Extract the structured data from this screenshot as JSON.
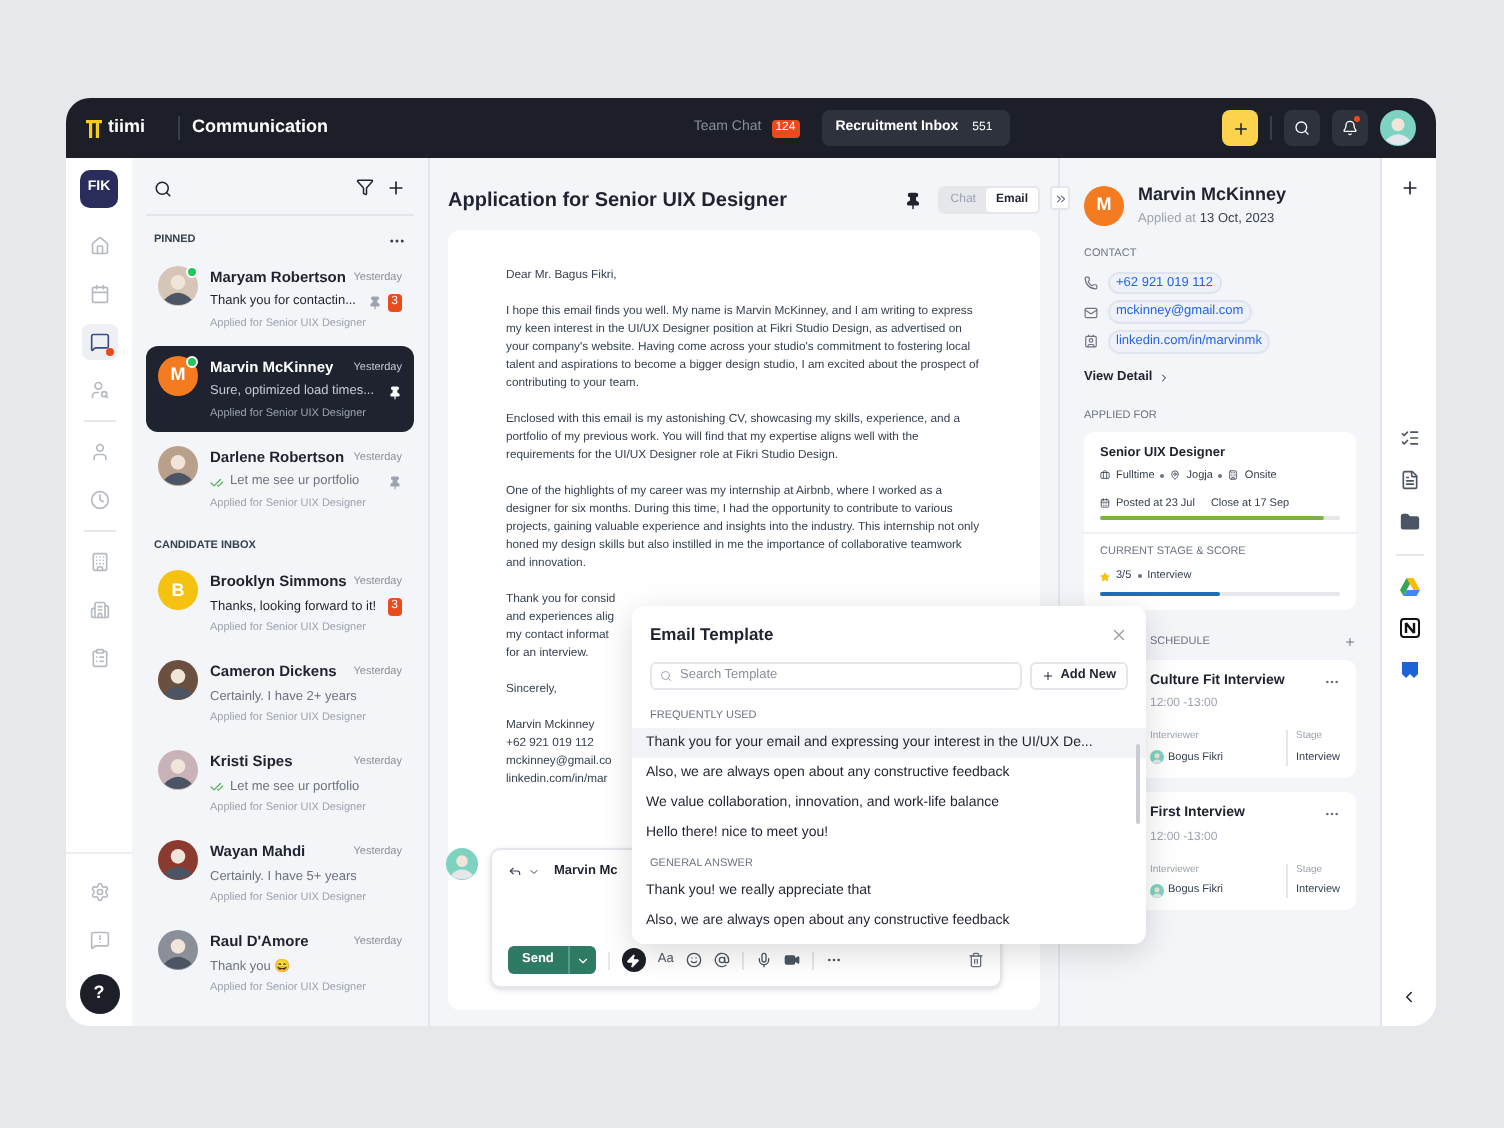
{
  "topbar": {
    "logo": "tiimi",
    "title": "Communication",
    "tabs": [
      {
        "label": "Team Chat",
        "count": "124",
        "selected": false
      },
      {
        "label": "Recruitment Inbox",
        "count": "551",
        "selected": true
      }
    ],
    "notification_dot": true
  },
  "rail": {
    "workspace": "FIK",
    "help": "?",
    "items": [
      {
        "selected": false,
        "badge": false
      },
      {
        "selected": false,
        "badge": false
      },
      {
        "selected": true,
        "badge": true
      },
      {
        "selected": false,
        "badge": false
      },
      {
        "selected": false,
        "badge": false
      },
      {
        "selected": false,
        "badge": false
      },
      {
        "selected": false,
        "badge": false
      },
      {
        "selected": false,
        "badge": false
      },
      {
        "selected": false,
        "badge": false
      }
    ]
  },
  "conversations": {
    "sections": [
      {
        "title": "PINNED",
        "items": [
          {
            "name": "Maryam Robertson",
            "time": "Yesterday",
            "message": "Thank you for contactin...",
            "subtitle": "Applied for Senior UIX Designer",
            "avatar": {
              "kind": "photo",
              "color": "#d6c6b8"
            },
            "online": true,
            "read": false,
            "pinned": true,
            "unread": "3",
            "selected": false
          },
          {
            "name": "Marvin McKinney",
            "time": "Yesterday",
            "message": "Sure, optimized load times...",
            "subtitle": "Applied for Senior UIX Designer",
            "avatar": {
              "kind": "initial",
              "letter": "M",
              "color": "#f47b20"
            },
            "online": true,
            "read": false,
            "pinned": true,
            "selected": true
          },
          {
            "name": "Darlene Robertson",
            "time": "Yesterday",
            "message": "Let me see ur portfolio",
            "subtitle": "Applied for Senior UIX Designer",
            "avatar": {
              "kind": "photo",
              "color": "#b9a08a"
            },
            "online": false,
            "read": true,
            "pinned": true,
            "selected": false
          }
        ]
      },
      {
        "title": "CANDIDATE INBOX",
        "items": [
          {
            "name": "Brooklyn Simmons",
            "time": "Yesterday",
            "message": "Thanks, looking forward to it!",
            "subtitle": "Applied for Senior UIX Designer",
            "avatar": {
              "kind": "initial",
              "letter": "B",
              "color": "#f5c211"
            },
            "online": false,
            "read": false,
            "pinned": false,
            "unread": "3",
            "selected": false
          },
          {
            "name": "Cameron Dickens",
            "time": "Yesterday",
            "message": "Certainly. I have 2+ years",
            "subtitle": "Applied for Senior UIX Designer",
            "avatar": {
              "kind": "photo",
              "color": "#6b4f3f"
            },
            "online": false,
            "read": false,
            "pinned": false,
            "selected": false
          },
          {
            "name": "Kristi Sipes",
            "time": "Yesterday",
            "message": "Let me see ur portfolio",
            "subtitle": "Applied for Senior UIX Designer",
            "avatar": {
              "kind": "photo",
              "color": "#c9b3b8"
            },
            "online": false,
            "read": true,
            "pinned": false,
            "selected": false
          },
          {
            "name": "Wayan Mahdi",
            "time": "Yesterday",
            "message": "Certainly. I have 5+ years",
            "subtitle": "Applied for Senior UIX Designer",
            "avatar": {
              "kind": "photo",
              "color": "#8b3a2f"
            },
            "online": false,
            "read": false,
            "pinned": false,
            "selected": false
          },
          {
            "name": "Raul D'Amore",
            "time": "Yesterday",
            "message": "Thank you 😄",
            "subtitle": "Applied for Senior UIX Designer",
            "avatar": {
              "kind": "photo",
              "color": "#8a8f98"
            },
            "online": false,
            "read": false,
            "pinned": false,
            "selected": false
          }
        ]
      }
    ]
  },
  "thread": {
    "title": "Application for Senior UIX Designer",
    "view_toggle": [
      {
        "label": "Chat",
        "selected": false
      },
      {
        "label": "Email",
        "selected": true
      }
    ],
    "email": {
      "greeting": "Dear Mr. Bagus Fikri,",
      "paragraphs": [
        "I hope this email finds you well. My name is Marvin McKinney, and I am writing to express my keen interest in the UI/UX Designer position at Fikri Studio Design, as advertised on your company's website. Having come across your studio's commitment to fostering local talent and aspirations to become a bigger design studio, I am excited about the prospect of contributing to your team.",
        "Enclosed with this email is my astonishing CV, showcasing my skills, experience, and a portfolio of my previous work. You will find that my expertise aligns well with the requirements for the UI/UX Designer role at Fikri Studio Design.",
        "One of the highlights of my career was my internship at Airbnb, where I worked as a designer for six months. During this time, I had the opportunity to contribute to various projects, gaining valuable experience and insights into the industry. This internship not only honed my design skills but also instilled in me the importance of collaborative teamwork and innovation."
      ],
      "covered_lines": [
        "Thank you for consid",
        "and experiences alig",
        "my contact informat",
        "for an interview."
      ],
      "closing": "Sincerely,",
      "signature": [
        "Marvin Mckinney",
        "+62 921 019 112",
        "mckinney@gmail.co",
        "linkedin.com/in/mar"
      ]
    },
    "composer": {
      "recipient": "Marvin Mc",
      "send": "Send",
      "format_label": "Aa"
    }
  },
  "template_popup": {
    "title": "Email Template",
    "search_placeholder": "Search Template",
    "add_button": "Add New",
    "groups": [
      {
        "title": "FREQUENTLY USED",
        "items": [
          {
            "text": "Thank you for your email and expressing your interest in the UI/UX De...",
            "selected": true
          },
          {
            "text": "Also, we are always open about any constructive feedback",
            "selected": false
          },
          {
            "text": "We value collaboration, innovation, and work-life balance",
            "selected": false
          },
          {
            "text": "Hello there! nice to meet you!",
            "selected": false
          }
        ]
      },
      {
        "title": "GENERAL ANSWER",
        "items": [
          {
            "text": "Thank you! we really appreciate that",
            "selected": false
          },
          {
            "text": "Also, we are always open about any constructive feedback",
            "selected": false
          }
        ]
      }
    ]
  },
  "candidate": {
    "initial": "M",
    "name": "Marvin McKinney",
    "applied_label": "Applied at",
    "applied_date": "13 Oct, 2023",
    "contact_title": "CONTACT",
    "contacts": [
      {
        "kind": "phone",
        "value": "+62 921 019 112"
      },
      {
        "kind": "email",
        "value": "mckinney@gmail.com"
      },
      {
        "kind": "profile",
        "value": "linkedin.com/in/marvinmk"
      }
    ],
    "view_detail": "View Detail",
    "applied_for_title": "APPLIED FOR",
    "job": {
      "title": "Senior UIX Designer",
      "meta": [
        {
          "kind": "type",
          "text": "Fulltime"
        },
        {
          "kind": "location",
          "text": "Jogja"
        },
        {
          "kind": "office",
          "text": "Onsite"
        }
      ],
      "posted": "Posted at 23 Jul",
      "close": "Close at 17 Sep",
      "level": 0.93
    },
    "stage_title": "CURRENT STAGE & SCORE",
    "score": "3/5",
    "stage": "Interview",
    "stage_progress": {
      "level": 0.5
    },
    "schedule_title": "SCHEDULE",
    "schedule": [
      {
        "title": "Culture Fit Interview",
        "time": "12:00 -13:00",
        "interviewer_label": "Interviewer",
        "interviewer": "Bogus Fikri",
        "stage_label": "Stage",
        "stage": "Interview"
      },
      {
        "title": "First Interview",
        "time": "12:00 -13:00",
        "interviewer_label": "Interviewer",
        "interviewer": "Bogus Fikri",
        "stage_label": "Stage",
        "stage": "Interview"
      }
    ]
  }
}
